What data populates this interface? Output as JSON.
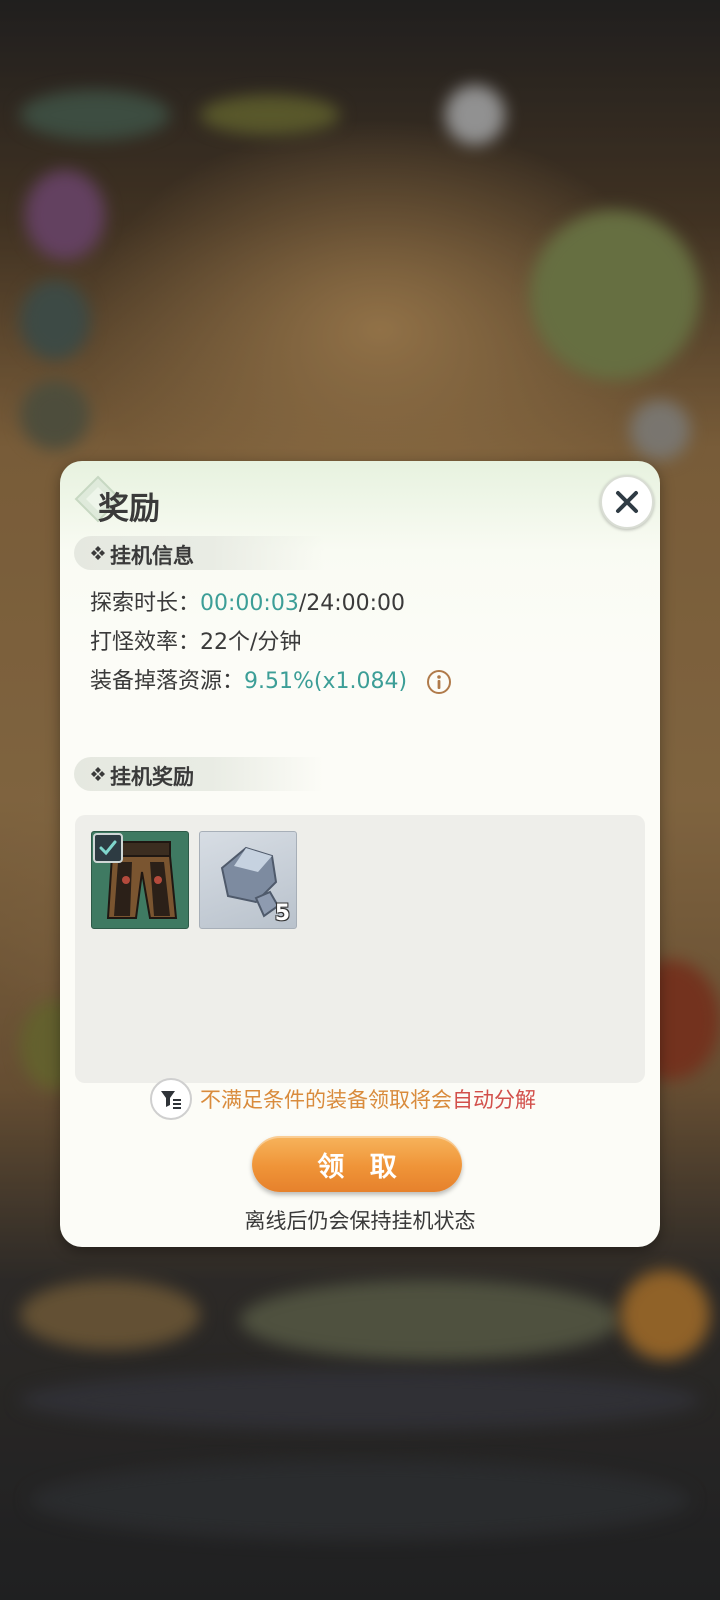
{
  "dialog": {
    "title": "奖励",
    "close_icon": "close-icon"
  },
  "idle_info": {
    "section_title": "挂机信息",
    "explore_time": {
      "label": "探索时长：",
      "current": "00:00:03",
      "max": "/24:00:00"
    },
    "kill_rate": {
      "label": "打怪效率：",
      "value": "22个/分钟"
    },
    "drop_resource": {
      "label": "装备掉落资源：",
      "value": "9.51%(x1.084)",
      "icon": "info-icon"
    }
  },
  "idle_rewards": {
    "section_title": "挂机奖励",
    "items": [
      {
        "icon": "armor-pants-icon",
        "selected": true,
        "quantity": ""
      },
      {
        "icon": "ore-crystal-icon",
        "selected": false,
        "quantity": "5"
      }
    ]
  },
  "notice": {
    "icon": "filter-icon",
    "text": "不满足条件的装备领取将会",
    "highlight": "自动分解"
  },
  "claim_button": "领 取",
  "footer_note": "离线后仍会保持挂机状态",
  "colors": {
    "accent_teal": "#3c9e97",
    "orange": "#ef9438",
    "notice_orange": "#d98b3c",
    "notice_red": "#d2504b"
  }
}
